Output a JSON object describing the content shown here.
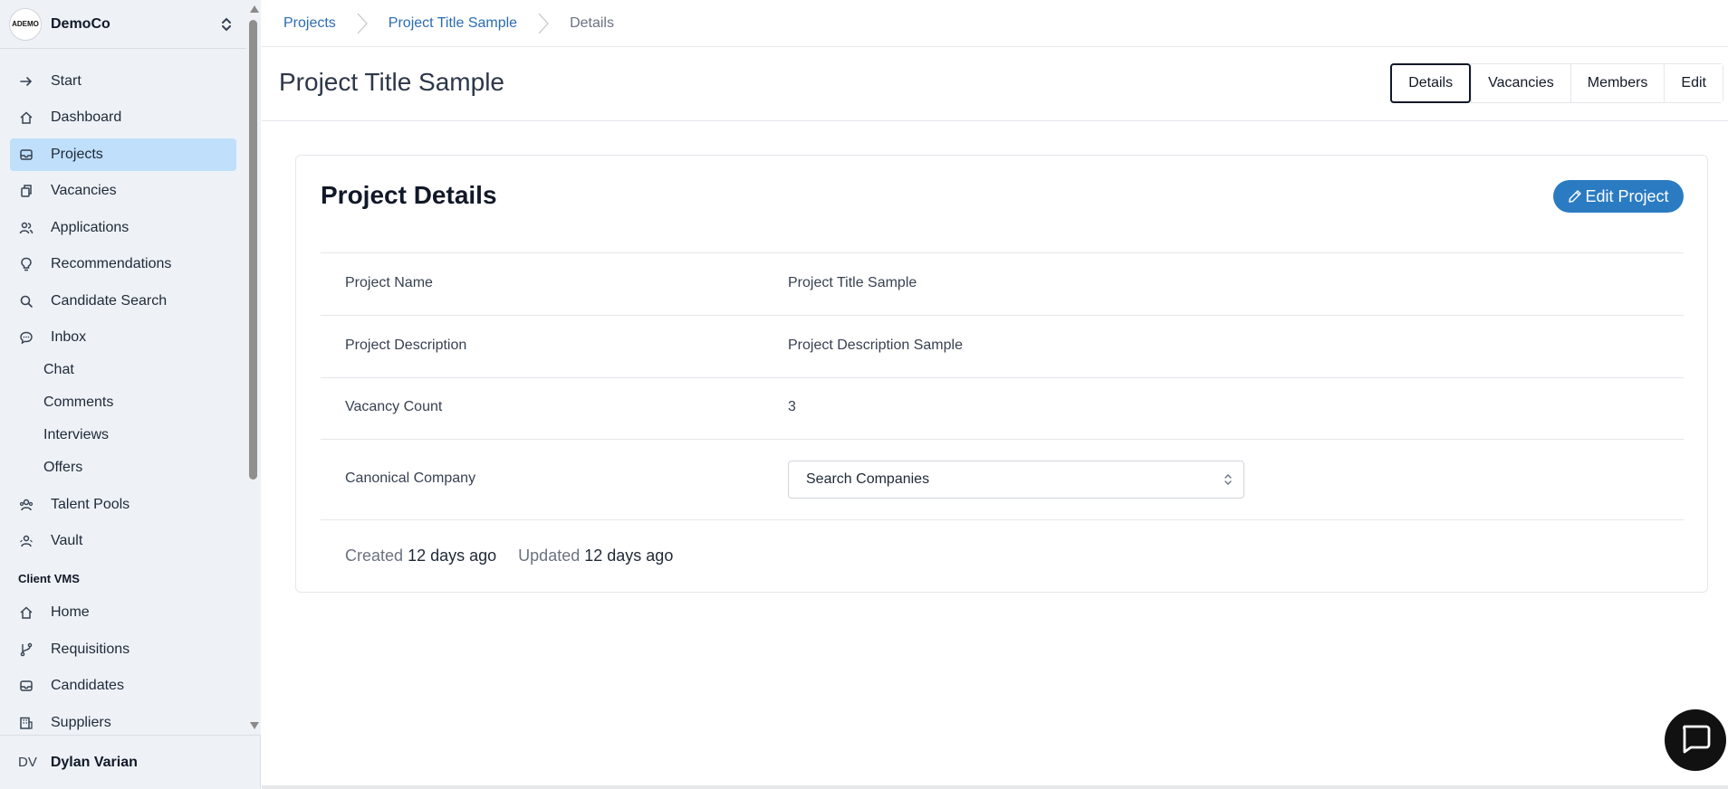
{
  "org": {
    "name": "DemoCo",
    "logo_text": "ADEMO"
  },
  "nav": {
    "items": [
      {
        "label": "Start",
        "icon": "arrow-right-icon"
      },
      {
        "label": "Dashboard",
        "icon": "home-icon"
      },
      {
        "label": "Projects",
        "icon": "inbox-icon",
        "active": true
      },
      {
        "label": "Vacancies",
        "icon": "copy-icon"
      },
      {
        "label": "Applications",
        "icon": "users-icon"
      },
      {
        "label": "Recommendations",
        "icon": "lightbulb-icon"
      },
      {
        "label": "Candidate Search",
        "icon": "search-icon"
      },
      {
        "label": "Inbox",
        "icon": "message-icon"
      }
    ],
    "inbox_sub": [
      "Chat",
      "Comments",
      "Interviews",
      "Offers"
    ],
    "items2": [
      {
        "label": "Talent Pools",
        "icon": "pool-icon"
      },
      {
        "label": "Vault",
        "icon": "vault-icon"
      }
    ],
    "section_label": "Client VMS",
    "items3": [
      {
        "label": "Home",
        "icon": "home-icon"
      },
      {
        "label": "Requisitions",
        "icon": "branch-icon"
      },
      {
        "label": "Candidates",
        "icon": "inbox-icon"
      },
      {
        "label": "Suppliers",
        "icon": "building-icon"
      }
    ]
  },
  "user": {
    "initials": "DV",
    "name": "Dylan Varian"
  },
  "breadcrumb": [
    "Projects",
    "Project Title Sample",
    "Details"
  ],
  "page_title": "Project Title Sample",
  "tabs": [
    "Details",
    "Vacancies",
    "Members",
    "Edit"
  ],
  "card": {
    "title": "Project Details",
    "edit_label": "Edit Project",
    "rows": [
      {
        "key": "Project Name",
        "value": "Project Title Sample"
      },
      {
        "key": "Project Description",
        "value": "Project Description Sample"
      },
      {
        "key": "Vacancy Count",
        "value": "3"
      },
      {
        "key": "Canonical Company",
        "value": "Search Companies"
      }
    ],
    "created_label": "Created",
    "created_value": "12 days ago",
    "updated_label": "Updated",
    "updated_value": "12 days ago"
  },
  "colors": {
    "accent": "#2b7bc2",
    "active_nav": "#bfdffb",
    "link": "#2b6cb0"
  }
}
